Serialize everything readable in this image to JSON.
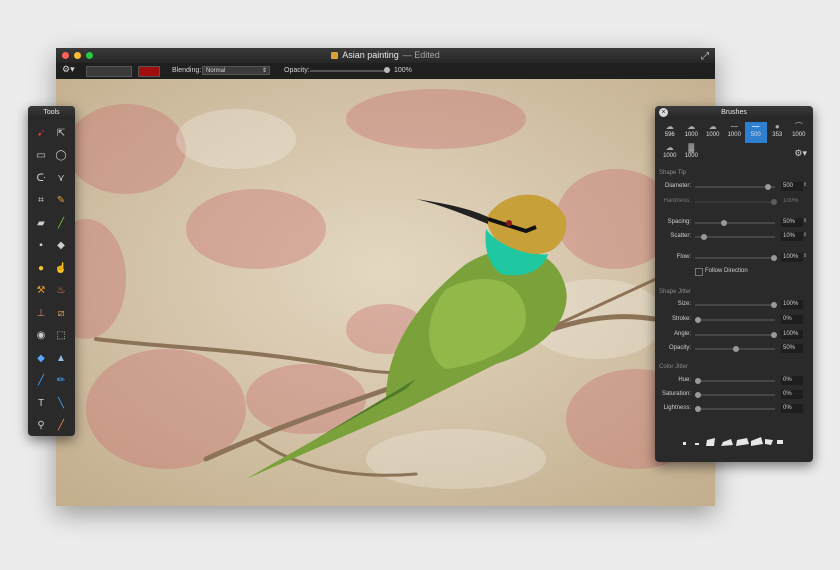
{
  "window": {
    "title": "Asian painting",
    "edited": "— Edited"
  },
  "toolbar": {
    "blending_label": "Blending:",
    "blending_value": "Normal",
    "opacity_label": "Opacity:",
    "opacity_value": "100%",
    "color": "#a10e0e"
  },
  "tools_panel": {
    "title": "Tools",
    "tools": [
      "select-arrow",
      "move",
      "rect-select",
      "ellipse-select",
      "lasso",
      "polygon-lasso",
      "crop",
      "eyedropper",
      "eraser",
      "paintbrush",
      "gradient",
      "paint-bucket",
      "sponge",
      "smudge",
      "brush-small",
      "burn",
      "stamp",
      "heal",
      "red-eye",
      "eraser-2",
      "blur",
      "sharpen",
      "pen",
      "pencil",
      "text",
      "line",
      "zoom",
      "color-picker"
    ]
  },
  "brushes_panel": {
    "title": "Brushes",
    "presets": [
      {
        "size": "596",
        "selected": false
      },
      {
        "size": "1000",
        "selected": false
      },
      {
        "size": "1000",
        "selected": false
      },
      {
        "size": "1000",
        "selected": false
      },
      {
        "size": "500",
        "selected": true
      },
      {
        "size": "353",
        "selected": false
      },
      {
        "size": "1000",
        "selected": false
      },
      {
        "size": "1000",
        "selected": false
      },
      {
        "size": "1000",
        "selected": false
      }
    ],
    "sections": {
      "shape_tip": "Shape Tip",
      "shape_jitter": "Shape Jitter",
      "color_jitter": "Color Jitter"
    },
    "props": {
      "diameter": {
        "label": "Diameter:",
        "value": "500"
      },
      "hardness": {
        "label": "Hardness:",
        "value": "100%"
      },
      "spacing": {
        "label": "Spacing:",
        "value": "50%"
      },
      "scatter": {
        "label": "Scatter:",
        "value": "10%"
      },
      "flow": {
        "label": "Flow:",
        "value": "100%"
      },
      "follow_direction": "Follow Direction",
      "size": {
        "label": "Size:",
        "value": "100%"
      },
      "stroke": {
        "label": "Stroke:",
        "value": "0%"
      },
      "angle": {
        "label": "Angle:",
        "value": "100%"
      },
      "opacity": {
        "label": "Opacity:",
        "value": "50%"
      },
      "hue": {
        "label": "Hue:",
        "value": "0%"
      },
      "saturation": {
        "label": "Saturation:",
        "value": "0%"
      },
      "lightness": {
        "label": "Lightness:",
        "value": "0%"
      }
    }
  }
}
